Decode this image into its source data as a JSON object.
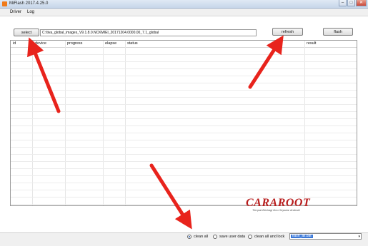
{
  "window": {
    "title": "MiFlash 2017.4.25.0",
    "controls": [
      "–",
      "□",
      "✕"
    ]
  },
  "menu": [
    "Driver",
    "Log"
  ],
  "toolbar": {
    "select_label": "select",
    "path_value": "C:\\tiva_global_images_V9.1.8.0.NCKMIEI_20171204.0000.00_7.1_global",
    "refresh_label": "refresh",
    "flash_label": "flash"
  },
  "table": {
    "columns": [
      "id",
      "device",
      "progress",
      "elapse",
      "status",
      "result"
    ]
  },
  "watermark": {
    "logo": "CARAROOT",
    "tagline": "Tempat Berbagi Ilmu Seputar Android"
  },
  "footer": {
    "options": [
      {
        "label": "clean all",
        "selected": true
      },
      {
        "label": "save user data",
        "selected": false
      },
      {
        "label": "clean all and lock",
        "selected": false
      }
    ],
    "script_value": "flash_all.bat",
    "dropdown_icon": "chevron-down-icon"
  },
  "colors": {
    "arrow": "#e8231c",
    "selection": "#3b78d8",
    "logo": "#b81e1e"
  }
}
